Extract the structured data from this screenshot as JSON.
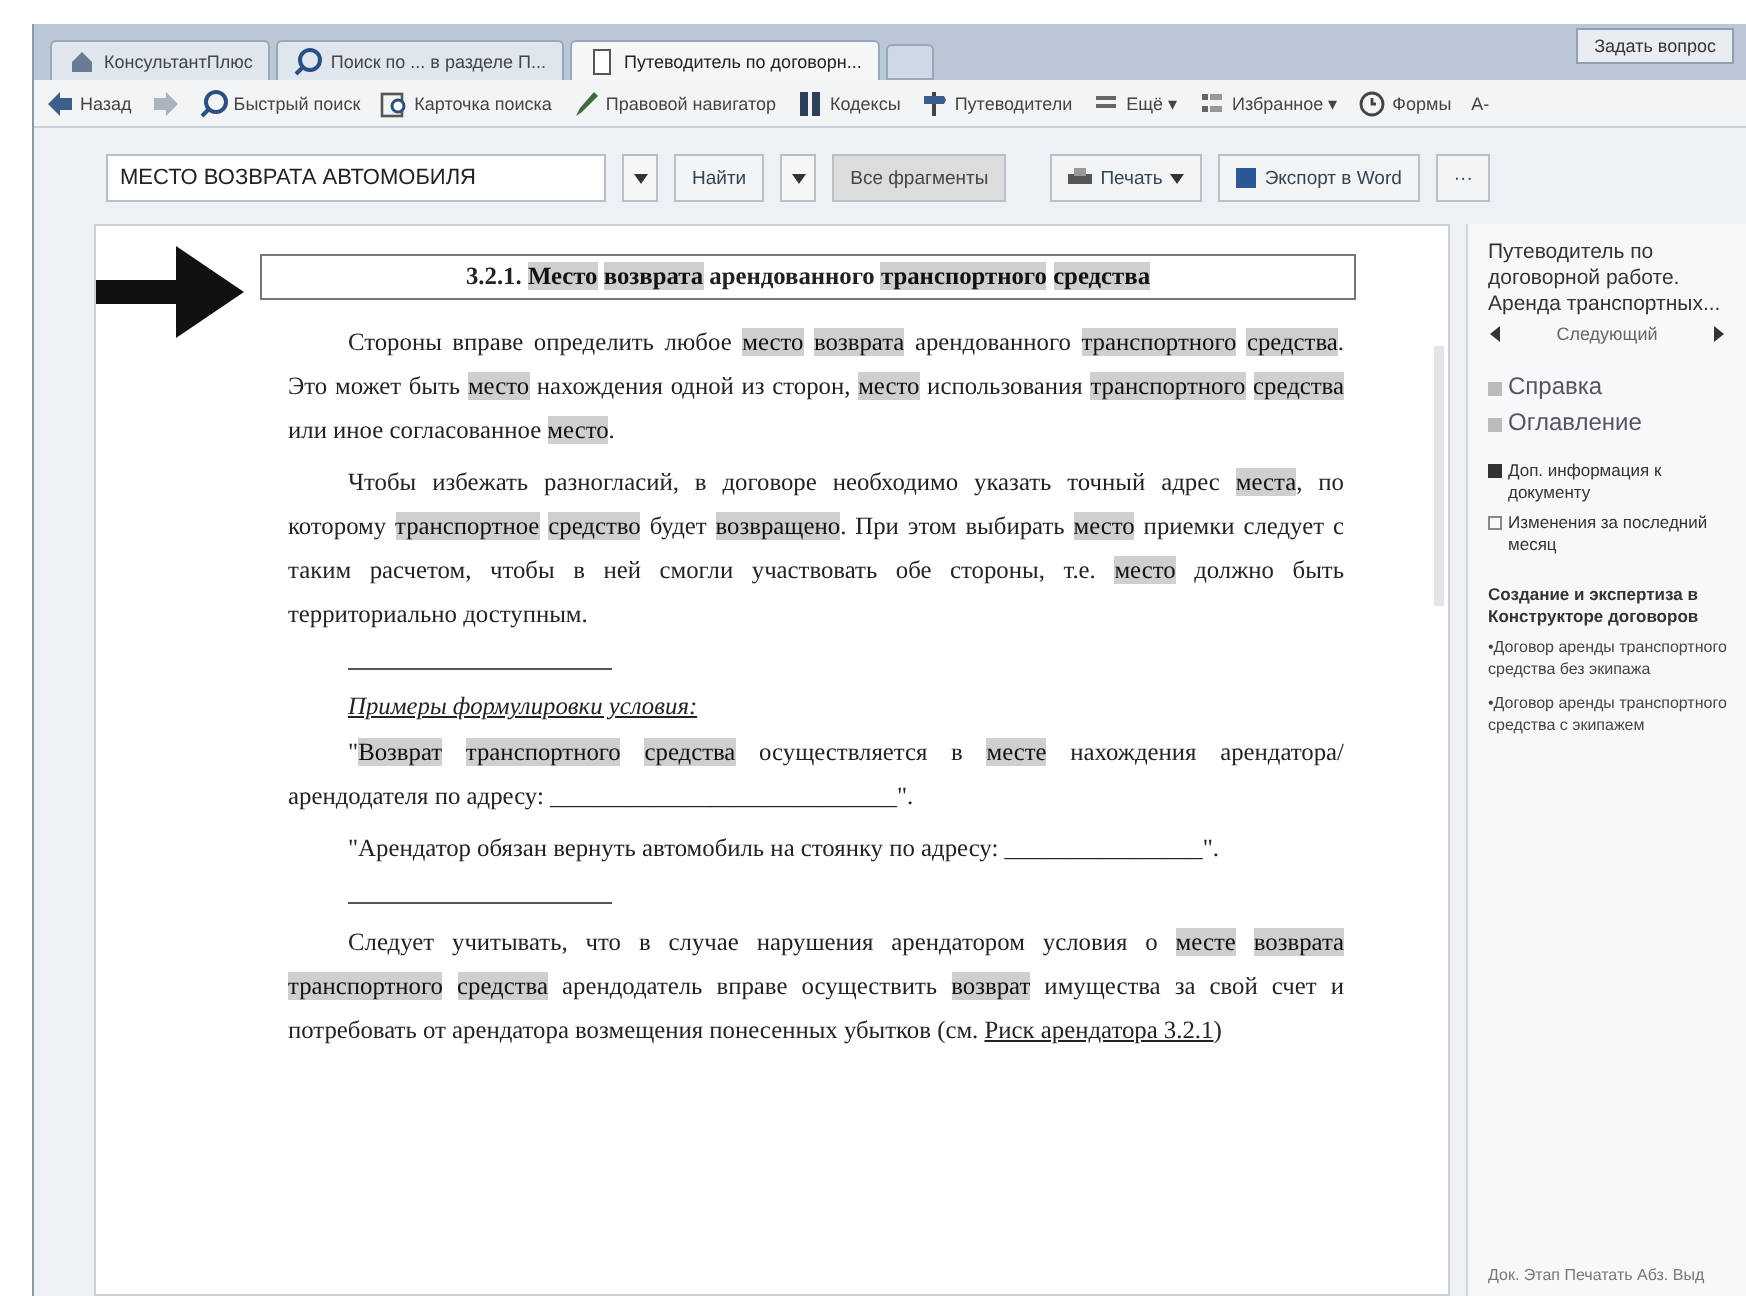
{
  "tabs": [
    {
      "label": "КонсультантПлюс",
      "selected": false,
      "kind": "home"
    },
    {
      "label": "Поиск по ... в разделе П...",
      "selected": false,
      "kind": "search"
    },
    {
      "label": "Путеводитель по договорн...",
      "selected": true,
      "kind": "doc"
    }
  ],
  "ask_button": "Задать вопрос",
  "nav": [
    {
      "kind": "back",
      "label": "Назад"
    },
    {
      "kind": "forward"
    },
    {
      "kind": "search",
      "label": "Быстрый поиск"
    },
    {
      "kind": "card",
      "label": "Карточка поиска"
    },
    {
      "kind": "pen",
      "label": "Правовой навигатор"
    },
    {
      "kind": "book",
      "label": "Кодексы"
    },
    {
      "kind": "guide",
      "label": "Путеводители"
    },
    {
      "kind": "menu",
      "label": "Ещё ▾"
    },
    {
      "kind": "star",
      "label": "Избранное ▾"
    },
    {
      "kind": "info",
      "label": "Формы"
    },
    {
      "kind": "text",
      "label": "A-"
    }
  ],
  "search": {
    "value": "МЕСТО ВОЗВРАТА АВТОМОБИЛЯ",
    "find": "Найти",
    "scope": "Все фрагменты",
    "print": "Печать",
    "export": "Экспорт в Word",
    "more": "···"
  },
  "document": {
    "heading": "3.2.1. **Место** **возврата** арендованного **транспортного** **средства**",
    "blocks": [
      {
        "kind": "para",
        "text": "Стороны вправе определить любое **место** **возврата** арендованного **транспортного** **средства**. Это может быть **место** нахождения одной из сторон, **место** использования **транспортного** **средства** или иное согласованное **место**."
      },
      {
        "kind": "para",
        "text": "Чтобы избежать разногласий, в договоре необходимо указать точный адрес **места**, по которому **транспортное** **средство** будет **возвращено**. При этом выбирать **место** приемки следует с таким расчетом, чтобы в ней смогли участвовать обе стороны, т.е. **место** должно быть территориально доступным."
      },
      {
        "kind": "rule"
      },
      {
        "kind": "caption",
        "text": "Примеры формулировки условия:"
      },
      {
        "kind": "para",
        "text": "\"**Возврат** **транспортного** **средства** осуществляется в **месте** нахождения арендатора/арендодателя по адресу: ____________________________\"."
      },
      {
        "kind": "para",
        "text": "\"Арендатор обязан вернуть автомобиль на стоянку по адресу: ________________\"."
      },
      {
        "kind": "rule"
      },
      {
        "kind": "para",
        "text": "Следует учитывать, что в случае нарушения арендатором условия о **месте** **возврата** **транспортного** **средства** арендодатель вправе осуществить **возврат** имущества за свой счет и потребовать от арендатора возмещения понесенных убытков (см.",
        "link": "Риск арендатора 3.2.1",
        "after": ")"
      }
    ]
  },
  "sidebar": {
    "title": "Путеводитель по договорной работе. Аренда транспортных...",
    "next": "Следующий",
    "items": [
      {
        "kind": "nav",
        "label": "Справка"
      },
      {
        "kind": "nav",
        "label": "Оглавление"
      },
      {
        "kind": "gap"
      },
      {
        "kind": "info",
        "label": "Доп. информация к документу"
      },
      {
        "kind": "changes",
        "label": "Изменения за последний месяц"
      },
      {
        "kind": "gap"
      },
      {
        "kind": "heading",
        "label": "Создание и экспертиза в Конструкторе договоров"
      },
      {
        "kind": "bullet",
        "label": "•Договор аренды транспортного средства без экипажа"
      },
      {
        "kind": "bullet",
        "label": "•Договор аренды транспортного средства с экипажем"
      }
    ]
  },
  "status_bar": "Док. Этап Печатать Абз. Выд"
}
